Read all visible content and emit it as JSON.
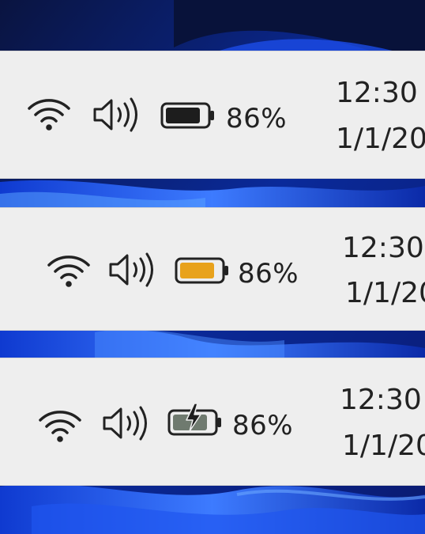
{
  "wallpaper": {
    "name": "bloom-wallpaper",
    "base_color": "#071a55",
    "accent_color": "#1e55ff"
  },
  "panels": [
    {
      "battery_state": "normal",
      "battery_fill_color": "#1d1d1d",
      "battery_level": 0.86,
      "battery_percent": "86%",
      "clock_time": "12:30",
      "clock_date": "1/1/20"
    },
    {
      "battery_state": "low-power",
      "battery_fill_color": "#e8a21c",
      "battery_level": 0.86,
      "battery_percent": "86%",
      "clock_time": "12:30",
      "clock_date": "1/1/20"
    },
    {
      "battery_state": "charging",
      "battery_fill_color": "#6f7a6f",
      "battery_level": 0.86,
      "battery_percent": "86%",
      "clock_time": "12:30",
      "clock_date": "1/1/20"
    }
  ],
  "icons": {
    "wifi": "wifi-icon",
    "volume": "volume-icon",
    "battery": "battery-icon",
    "charging": "lightning-bolt-icon"
  }
}
